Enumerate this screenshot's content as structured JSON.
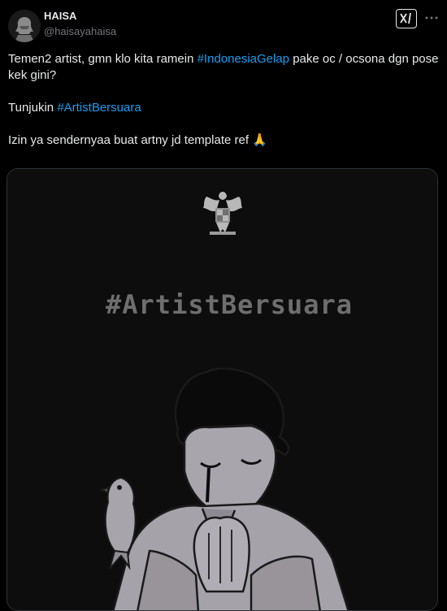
{
  "author": {
    "name": "HAISA",
    "handle": "@haisayahaisa"
  },
  "icons": {
    "grok": "grok-icon",
    "more": "more-icon",
    "pray": "folded-hands-emoji"
  },
  "tweet": {
    "line1_before": "Temen2 artist, gmn klo kita ramein ",
    "hashtag1": "#IndonesiaGelap",
    "line1_after": " pake oc / ocsona dgn pose kek gini?",
    "line2_before": "Tunjukin ",
    "hashtag2": "#ArtistBersuara",
    "line3": "Izin ya sendernyaa buat artny jd template ref ",
    "emoji": "🙏"
  },
  "media": {
    "image_text": "#ArtistBersuara"
  },
  "colors": {
    "background": "#000000",
    "text": "#e7e9ea",
    "secondary": "#71767b",
    "link": "#1d9bf0"
  }
}
